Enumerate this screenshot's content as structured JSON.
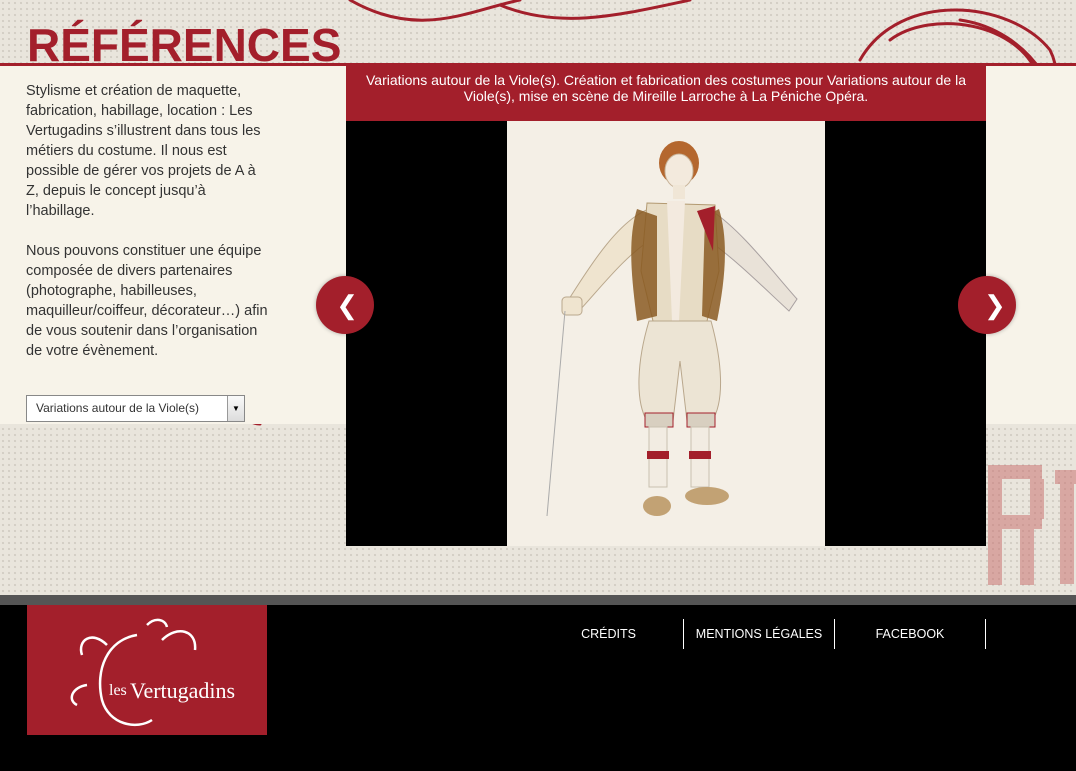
{
  "page": {
    "title": "RÉFÉRENCES"
  },
  "intro": {
    "paragraph1": "Stylisme et création de maquette, fabrication, habillage, location : Les Vertugadins s’illustrent dans tous les métiers du costume. Il nous est possible de gérer vos projets de A à Z, depuis le concept jusqu’à l’habillage.",
    "paragraph2": "Nous pouvons constituer une équipe composée de divers partenaires (photographe, habilleuses, maquilleur/coiffeur, décorateur…) afin de vous soutenir dans l’organisation de votre évènement."
  },
  "project_select": {
    "selected": "Variations autour de la Viole(s)",
    "arrow": "▼"
  },
  "slideshow": {
    "caption": "Variations autour de la Viole(s). Création et fabrication des costumes pour Variations autour de la Viole(s), mise en scène de Mireille Larroche à La Péniche Opéra.",
    "prev": "❮",
    "next": "❯"
  },
  "footer": {
    "logo_text_small": "les",
    "logo_text_big": "Vertugadins",
    "links": [
      "CRÉDITS",
      "MENTIONS LÉGALES",
      "FACEBOOK"
    ]
  },
  "colors": {
    "accent": "#a31f2b",
    "panel": "#f7f3e9",
    "footer": "#000000"
  }
}
